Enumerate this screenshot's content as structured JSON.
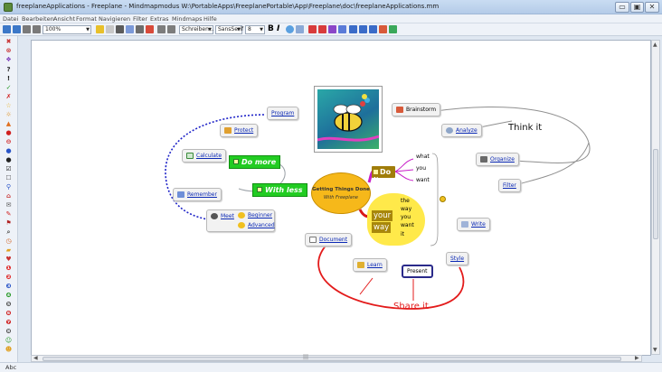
{
  "window": {
    "title": "freeplaneApplications - Freeplane - Mindmapmodus W:\\PortableApps\\FreeplanePortable\\App\\Freeplane\\doc\\freeplaneApplications.mm",
    "buttons": [
      "▭",
      "▣",
      "✕"
    ]
  },
  "menu": [
    "Datei",
    "Bearbeiten",
    "Ansicht",
    "Format",
    "Navigieren",
    "Filter",
    "Extras",
    "Mindmaps",
    "Hilfe"
  ],
  "toolbar": {
    "zoom": "100%",
    "font_mode": "Schreiben...",
    "font_family": "SansSerif",
    "font_size": "8",
    "bold": "B",
    "italic": "I"
  },
  "status": "Abc",
  "map": {
    "center": {
      "line1": "Getting Things Done",
      "line2": "With Freeplane"
    },
    "do_it": "Do it",
    "do_it_children": [
      "what",
      "you",
      "want"
    ],
    "cloud_words": [
      "your",
      "way"
    ],
    "cloud_children": [
      "the",
      "way",
      "you",
      "want",
      "it"
    ],
    "left": {
      "program": "Program",
      "protect": "Protect",
      "calculate": "Calculate",
      "do_more": "Do more",
      "with_less": "With less",
      "remember": "Remember",
      "meet": "Meet",
      "beginner": "Beginner",
      "advanced": "Advanced"
    },
    "right": {
      "brainstorm": "Brainstorm",
      "think_it": "Think it",
      "analyze": "Analyze",
      "organize": "Organize",
      "filter": "Filter",
      "write": "Write",
      "style": "Style"
    },
    "bottom": {
      "document": "Document",
      "learn": "Learn",
      "present": "Present",
      "share_it": "Share it"
    }
  },
  "colors": {
    "canvas": "#ffffff",
    "center": "#f6b81a",
    "cloud": "#ffe94a",
    "green": "#22cc22",
    "share_line": "#e31b1b",
    "meet_line": "#1f24c8"
  }
}
